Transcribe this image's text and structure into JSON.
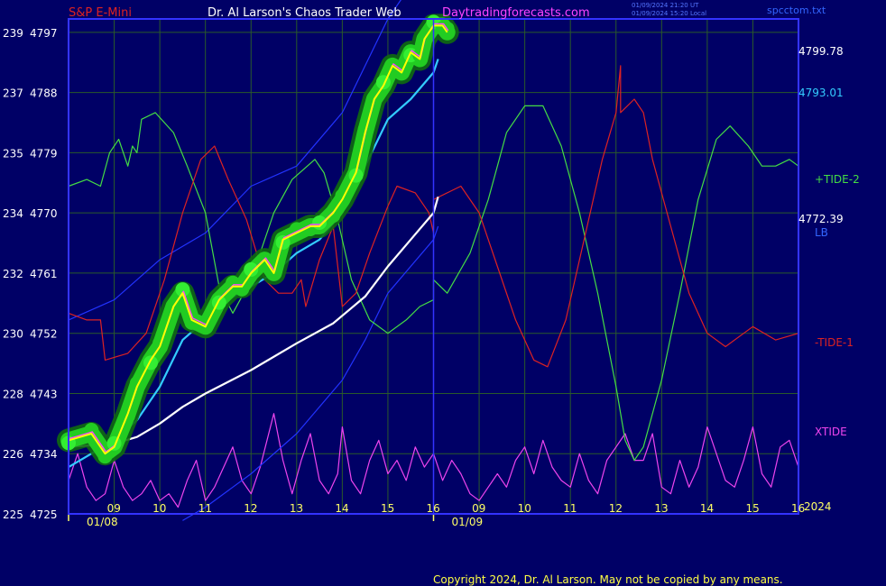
{
  "header": {
    "instrument": "S&P E-Mini",
    "site_title": "Dr. Al Larson's Chaos Trader Web",
    "site_url": "Daytradingforecasts.com",
    "time_ut": "01/09/2024 21:20 UT",
    "time_local": "01/09/2024 15:20 Local",
    "filename": "spcctom.txt"
  },
  "footer": {
    "copyright": "Copyright 2024, Dr. Al Larson. May not be copied by any means."
  },
  "colors": {
    "background": "#000066",
    "plot_border": "#3333ff",
    "grid": "#2a5a2a",
    "price_yellow": "#ffff00",
    "price_magenta": "#ff44ff",
    "glow": "#22cc22",
    "cyan_ma": "#33ccff",
    "white_ma": "#ffffff",
    "tide2_green": "#44dd44",
    "tide1_red": "#dd2222",
    "xtide_magenta": "#ee44ee",
    "channel_blue": "#2233ff",
    "axis_text": "#ffffff",
    "date_text": "#ffff66"
  },
  "chart_data": {
    "type": "line",
    "title": "S&P E-Mini",
    "y_left_index_ticks": [
      "239",
      "237",
      "235",
      "234",
      "232",
      "230",
      "228",
      "226",
      "225"
    ],
    "y_left_price_ticks": [
      4797,
      4788,
      4779,
      4770,
      4761,
      4752,
      4743,
      4734,
      4725
    ],
    "ylim": [
      4725,
      4799
    ],
    "x_hour_ticks_day1": [
      "09",
      "10",
      "11",
      "12",
      "13",
      "14",
      "15",
      "16"
    ],
    "x_hour_ticks_day2": [
      "09",
      "10",
      "11",
      "12",
      "13",
      "14",
      "15",
      "16"
    ],
    "dates": [
      "01/08",
      "01/09"
    ],
    "x_range_hours": [
      8,
      24
    ],
    "year_label": "2024",
    "right_labels": {
      "last_price": "4799.78",
      "level_1": "4793.01",
      "level_2": "4772.39",
      "tide2": "+TIDE-2",
      "lb": "LB",
      "tide1": "-TIDE-1",
      "xtide": "XTIDE"
    },
    "right_label_values": {
      "last_price": 4799.78,
      "level_1": 4793.01,
      "level_2": 4772.39
    },
    "series": [
      {
        "name": "price",
        "points": [
          [
            8.0,
            4736
          ],
          [
            8.5,
            4737
          ],
          [
            8.8,
            4734
          ],
          [
            9.0,
            4735
          ],
          [
            9.3,
            4740
          ],
          [
            9.5,
            4744
          ],
          [
            9.8,
            4748
          ],
          [
            10.0,
            4750
          ],
          [
            10.3,
            4756
          ],
          [
            10.5,
            4758
          ],
          [
            10.7,
            4754
          ],
          [
            11.0,
            4753
          ],
          [
            11.3,
            4757
          ],
          [
            11.6,
            4759
          ],
          [
            11.8,
            4759
          ],
          [
            12.0,
            4761
          ],
          [
            12.3,
            4763
          ],
          [
            12.5,
            4761
          ],
          [
            12.7,
            4766
          ],
          [
            13.0,
            4767
          ],
          [
            13.3,
            4768
          ],
          [
            13.5,
            4768
          ],
          [
            13.8,
            4770
          ],
          [
            14.0,
            4772
          ],
          [
            14.3,
            4776
          ],
          [
            14.5,
            4782
          ],
          [
            14.7,
            4787
          ],
          [
            14.9,
            4789
          ],
          [
            15.1,
            4792
          ],
          [
            15.3,
            4791
          ],
          [
            15.5,
            4794
          ],
          [
            15.7,
            4793
          ],
          [
            15.8,
            4796
          ],
          [
            16.0,
            4798
          ],
          [
            16.2,
            4798
          ],
          [
            16.3,
            4797
          ]
        ]
      },
      {
        "name": "cyan moving average",
        "points": [
          [
            8.0,
            4732
          ],
          [
            8.5,
            4734
          ],
          [
            9.0,
            4736
          ],
          [
            9.5,
            4739
          ],
          [
            10.0,
            4744
          ],
          [
            10.5,
            4751
          ],
          [
            11.0,
            4754
          ],
          [
            11.5,
            4757
          ],
          [
            12.0,
            4759
          ],
          [
            12.5,
            4761
          ],
          [
            13.0,
            4764
          ],
          [
            13.5,
            4766
          ],
          [
            14.0,
            4770
          ],
          [
            14.5,
            4777
          ],
          [
            15.0,
            4784
          ],
          [
            15.5,
            4787
          ],
          [
            16.0,
            4791
          ],
          [
            16.1,
            4793
          ]
        ]
      },
      {
        "name": "white moving average",
        "points": [
          [
            8.0,
            4735
          ],
          [
            9.0,
            4735.5
          ],
          [
            9.5,
            4736.5
          ],
          [
            10.0,
            4738.5
          ],
          [
            10.5,
            4741
          ],
          [
            11.0,
            4743
          ],
          [
            12.0,
            4746.5
          ],
          [
            13.0,
            4750.5
          ],
          [
            13.8,
            4753.5
          ],
          [
            14.5,
            4757.5
          ],
          [
            15.0,
            4762
          ],
          [
            15.5,
            4766
          ],
          [
            16.0,
            4770
          ],
          [
            16.1,
            4772.4
          ]
        ]
      },
      {
        "name": "upper channel",
        "points": [
          [
            8.0,
            4754
          ],
          [
            9.0,
            4757
          ],
          [
            10.0,
            4763
          ],
          [
            11.0,
            4767
          ],
          [
            12.0,
            4774
          ],
          [
            13.0,
            4777
          ],
          [
            14.0,
            4785
          ],
          [
            14.5,
            4792
          ],
          [
            15.0,
            4799
          ],
          [
            15.3,
            4802
          ]
        ]
      },
      {
        "name": "lower channel",
        "points": [
          [
            10.5,
            4724
          ],
          [
            11.0,
            4726
          ],
          [
            12.0,
            4731
          ],
          [
            13.0,
            4737
          ],
          [
            14.0,
            4745
          ],
          [
            14.5,
            4751
          ],
          [
            15.0,
            4758
          ],
          [
            15.5,
            4762
          ],
          [
            16.0,
            4766
          ],
          [
            16.1,
            4768
          ]
        ]
      },
      {
        "name": "+TIDE-2",
        "points": [
          [
            8.0,
            4774
          ],
          [
            8.4,
            4775
          ],
          [
            8.7,
            4774
          ],
          [
            8.9,
            4779
          ],
          [
            9.1,
            4781
          ],
          [
            9.3,
            4777
          ],
          [
            9.4,
            4780
          ],
          [
            9.5,
            4779
          ],
          [
            9.6,
            4784
          ],
          [
            9.9,
            4785
          ],
          [
            10.3,
            4782
          ],
          [
            10.6,
            4777
          ],
          [
            11.0,
            4770
          ],
          [
            11.3,
            4759
          ],
          [
            11.6,
            4755
          ],
          [
            12.0,
            4760
          ],
          [
            12.5,
            4770
          ],
          [
            12.9,
            4775
          ],
          [
            13.4,
            4778
          ],
          [
            13.6,
            4776
          ],
          [
            13.9,
            4769
          ],
          [
            14.2,
            4760
          ],
          [
            14.6,
            4754
          ],
          [
            15.0,
            4752
          ],
          [
            15.4,
            4754
          ],
          [
            15.7,
            4756
          ],
          [
            16.0,
            4757
          ],
          [
            16.0,
            4760
          ],
          [
            16.3,
            4758
          ],
          [
            16.8,
            4764
          ],
          [
            17.2,
            4772
          ],
          [
            17.6,
            4782
          ],
          [
            18.0,
            4786
          ],
          [
            18.4,
            4786
          ],
          [
            18.8,
            4780
          ],
          [
            19.2,
            4770
          ],
          [
            19.6,
            4758
          ],
          [
            20.0,
            4744
          ],
          [
            20.2,
            4736
          ],
          [
            20.4,
            4733
          ],
          [
            20.6,
            4735
          ],
          [
            21.0,
            4745
          ],
          [
            21.4,
            4758
          ],
          [
            21.8,
            4772
          ],
          [
            22.2,
            4781
          ],
          [
            22.5,
            4783
          ],
          [
            22.9,
            4780
          ],
          [
            23.2,
            4777
          ],
          [
            23.5,
            4777
          ],
          [
            23.8,
            4778
          ],
          [
            24.0,
            4777
          ]
        ]
      },
      {
        "name": "-TIDE-1",
        "points": [
          [
            8.0,
            4755
          ],
          [
            8.4,
            4754
          ],
          [
            8.7,
            4754
          ],
          [
            8.8,
            4748
          ],
          [
            9.3,
            4749
          ],
          [
            9.7,
            4752
          ],
          [
            10.1,
            4760
          ],
          [
            10.5,
            4770
          ],
          [
            10.9,
            4778
          ],
          [
            11.2,
            4780
          ],
          [
            11.5,
            4775
          ],
          [
            11.9,
            4769
          ],
          [
            12.3,
            4760
          ],
          [
            12.6,
            4758
          ],
          [
            12.9,
            4758
          ],
          [
            13.1,
            4760
          ],
          [
            13.2,
            4756
          ],
          [
            13.5,
            4763
          ],
          [
            13.8,
            4768
          ],
          [
            14.0,
            4756
          ],
          [
            14.3,
            4758
          ],
          [
            14.6,
            4764
          ],
          [
            15.0,
            4771
          ],
          [
            15.2,
            4774
          ],
          [
            15.6,
            4773
          ],
          [
            15.9,
            4770
          ],
          [
            16.0,
            4767
          ],
          [
            16.0,
            4772
          ],
          [
            16.6,
            4774
          ],
          [
            17.0,
            4770
          ],
          [
            17.4,
            4762
          ],
          [
            17.8,
            4754
          ],
          [
            18.2,
            4748
          ],
          [
            18.5,
            4747
          ],
          [
            18.9,
            4754
          ],
          [
            19.3,
            4766
          ],
          [
            19.7,
            4778
          ],
          [
            20.0,
            4785
          ],
          [
            20.1,
            4792
          ],
          [
            20.1,
            4785
          ],
          [
            20.4,
            4787
          ],
          [
            20.6,
            4785
          ],
          [
            20.8,
            4778
          ],
          [
            21.2,
            4768
          ],
          [
            21.6,
            4758
          ],
          [
            22.0,
            4752
          ],
          [
            22.4,
            4750
          ],
          [
            22.8,
            4752
          ],
          [
            23.0,
            4753
          ],
          [
            23.5,
            4751
          ],
          [
            24.0,
            4752
          ]
        ]
      },
      {
        "name": "XTIDE",
        "note_units": "cycle amplitude drawn in bottom band",
        "points": [
          [
            8.0,
            4730
          ],
          [
            8.2,
            4734
          ],
          [
            8.4,
            4729
          ],
          [
            8.6,
            4727
          ],
          [
            8.8,
            4728
          ],
          [
            9.0,
            4733
          ],
          [
            9.2,
            4729
          ],
          [
            9.4,
            4727
          ],
          [
            9.6,
            4728
          ],
          [
            9.8,
            4730
          ],
          [
            10.0,
            4727
          ],
          [
            10.2,
            4728
          ],
          [
            10.4,
            4726
          ],
          [
            10.6,
            4730
          ],
          [
            10.8,
            4733
          ],
          [
            11.0,
            4727
          ],
          [
            11.2,
            4729
          ],
          [
            11.4,
            4732
          ],
          [
            11.6,
            4735
          ],
          [
            11.8,
            4730
          ],
          [
            12.0,
            4728
          ],
          [
            12.2,
            4732
          ],
          [
            12.5,
            4740
          ],
          [
            12.7,
            4733
          ],
          [
            12.9,
            4728
          ],
          [
            13.1,
            4733
          ],
          [
            13.3,
            4737
          ],
          [
            13.5,
            4730
          ],
          [
            13.7,
            4728
          ],
          [
            13.9,
            4731
          ],
          [
            14.0,
            4738
          ],
          [
            14.2,
            4730
          ],
          [
            14.4,
            4728
          ],
          [
            14.6,
            4733
          ],
          [
            14.8,
            4736
          ],
          [
            15.0,
            4731
          ],
          [
            15.2,
            4733
          ],
          [
            15.4,
            4730
          ],
          [
            15.6,
            4735
          ],
          [
            15.8,
            4732
          ],
          [
            16.0,
            4734
          ],
          [
            16.2,
            4730
          ],
          [
            16.4,
            4733
          ],
          [
            16.6,
            4731
          ],
          [
            16.8,
            4728
          ],
          [
            17.0,
            4727
          ],
          [
            17.2,
            4729
          ],
          [
            17.4,
            4731
          ],
          [
            17.6,
            4729
          ],
          [
            17.8,
            4733
          ],
          [
            18.0,
            4735
          ],
          [
            18.2,
            4731
          ],
          [
            18.4,
            4736
          ],
          [
            18.6,
            4732
          ],
          [
            18.8,
            4730
          ],
          [
            19.0,
            4729
          ],
          [
            19.2,
            4734
          ],
          [
            19.4,
            4730
          ],
          [
            19.6,
            4728
          ],
          [
            19.8,
            4733
          ],
          [
            20.0,
            4735
          ],
          [
            20.2,
            4737
          ],
          [
            20.4,
            4733
          ],
          [
            20.6,
            4733
          ],
          [
            20.8,
            4737
          ],
          [
            21.0,
            4729
          ],
          [
            21.2,
            4728
          ],
          [
            21.4,
            4733
          ],
          [
            21.6,
            4729
          ],
          [
            21.8,
            4732
          ],
          [
            22.0,
            4738
          ],
          [
            22.2,
            4734
          ],
          [
            22.4,
            4730
          ],
          [
            22.6,
            4729
          ],
          [
            22.8,
            4733
          ],
          [
            23.0,
            4738
          ],
          [
            23.2,
            4731
          ],
          [
            23.4,
            4729
          ],
          [
            23.6,
            4735
          ],
          [
            23.8,
            4736
          ],
          [
            24.0,
            4732
          ]
        ]
      }
    ],
    "grid": true,
    "legend": "right-side labels"
  }
}
